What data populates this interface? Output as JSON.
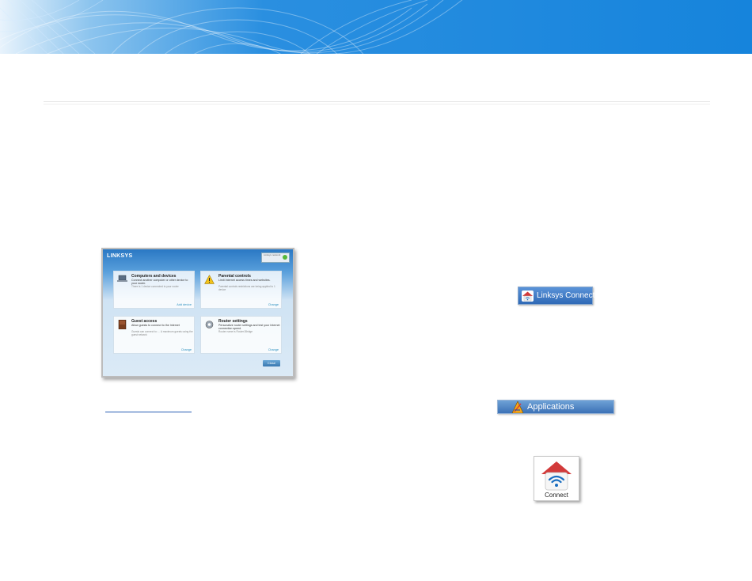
{
  "app_screenshot": {
    "logo": "LINKSYS",
    "status_text": "Linksys network",
    "panels": [
      {
        "title": "Computers and devices",
        "desc": "Connect another computer or other device to your router.",
        "note": "There is 1 device connected to your router",
        "link": "Add device"
      },
      {
        "title": "Parental controls",
        "desc": "Limit Internet access times and websites.",
        "note": "Parental controls restrictions are being applied to 1 device",
        "link": "Change"
      },
      {
        "title": "Guest access",
        "desc": "Allow guests to connect to the Internet",
        "note": "Guests can connect to: ... A maximum guests using the guest network",
        "link": "Change"
      },
      {
        "title": "Router settings",
        "desc": "Personalize router settings and test your Internet connection speed.",
        "note": "Router name is Router1Bridge",
        "link": "Change"
      }
    ],
    "button": "Close"
  },
  "linksys_connect": {
    "label": "Linksys Connect",
    "icon": "router-home-icon"
  },
  "applications": {
    "label": "Applications",
    "icon": "applications-folder-icon"
  },
  "connect_tile": {
    "label": "Connect",
    "icon": "house-wifi-icon"
  },
  "colors": {
    "banner": "#1a8ae0",
    "button_blue": "#2f69b6",
    "link": "#2a5fb4",
    "house_red": "#d23a3a"
  }
}
